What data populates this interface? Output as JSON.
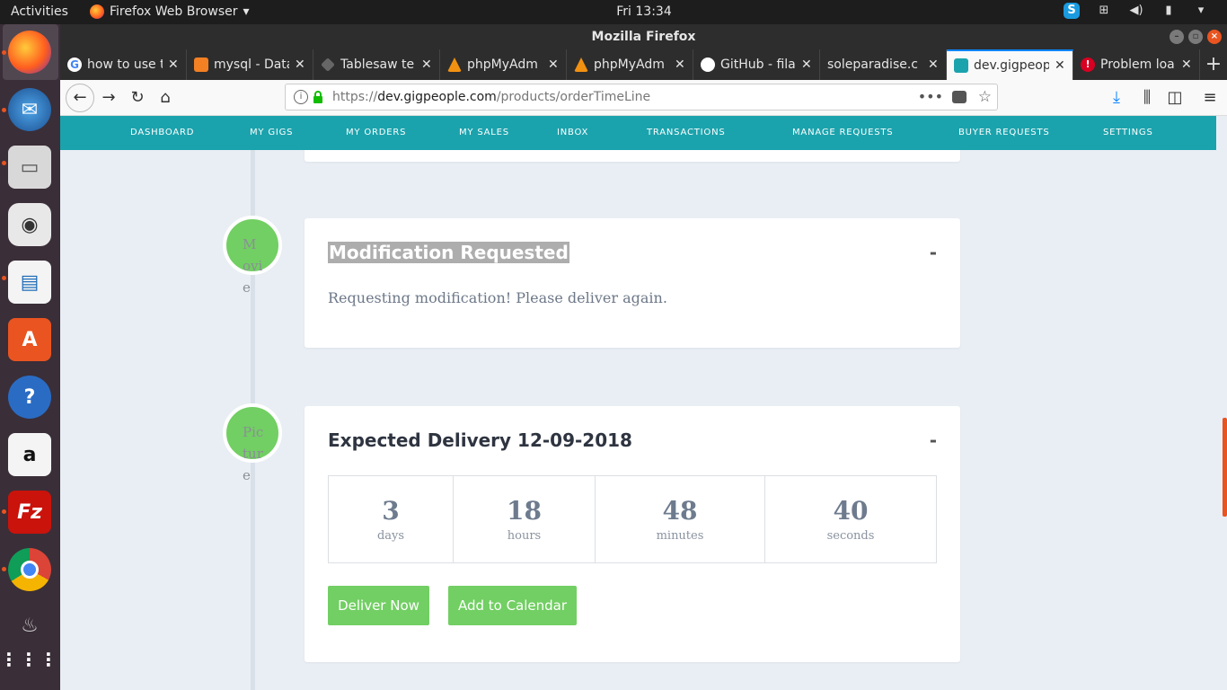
{
  "topbar": {
    "activities": "Activities",
    "app_menu": "Firefox Web Browser",
    "clock": "Fri 13:34"
  },
  "window": {
    "title": "Mozilla Firefox"
  },
  "tabs": [
    {
      "label": "how to use t",
      "favicon": "google-icon",
      "color": "#ffffff"
    },
    {
      "label": "mysql - Data",
      "favicon": "stackoverflow-icon",
      "color": "#f48024"
    },
    {
      "label": "Tablesaw te",
      "favicon": "tablesaw-icon",
      "color": "#555555"
    },
    {
      "label": "phpMyAdm",
      "favicon": "phpmyadmin-icon",
      "color": "#f29111"
    },
    {
      "label": "phpMyAdm",
      "favicon": "phpmyadmin-icon",
      "color": "#f29111"
    },
    {
      "label": "GitHub - fila",
      "favicon": "github-icon",
      "color": "#ffffff"
    },
    {
      "label": "soleparadise.c",
      "favicon": "none",
      "color": "#2d2d2d"
    },
    {
      "label": "dev.gigpeop",
      "favicon": "gigpeople-icon",
      "color": "#1ba3ad"
    },
    {
      "label": "Problem loa",
      "favicon": "error-icon",
      "color": "#d70022"
    }
  ],
  "url": {
    "scheme": "https://",
    "host": "dev.gigpeople.com",
    "path": "/products/orderTimeLine"
  },
  "site_nav": [
    "DASHBOARD",
    "MY GIGS",
    "MY ORDERS",
    "MY SALES",
    "INBOX",
    "TRANSACTIONS",
    "MANAGE REQUESTS",
    "BUYER REQUESTS",
    "SETTINGS"
  ],
  "timeline": {
    "modification": {
      "badge": "Movie",
      "title": "Modification Requested",
      "collapse": "-",
      "body": "Requesting modification! Please deliver again."
    },
    "delivery": {
      "badge": "Picture",
      "title": "Expected Delivery 12-09-2018",
      "collapse": "-",
      "countdown": [
        {
          "value": "3",
          "unit": "days"
        },
        {
          "value": "18",
          "unit": "hours"
        },
        {
          "value": "48",
          "unit": "minutes"
        },
        {
          "value": "40",
          "unit": "seconds"
        }
      ],
      "deliver_button": "Deliver Now",
      "calendar_button": "Add to Calendar"
    }
  },
  "colors": {
    "accent_teal": "#1ba3ad",
    "badge_green": "#72cf63"
  }
}
